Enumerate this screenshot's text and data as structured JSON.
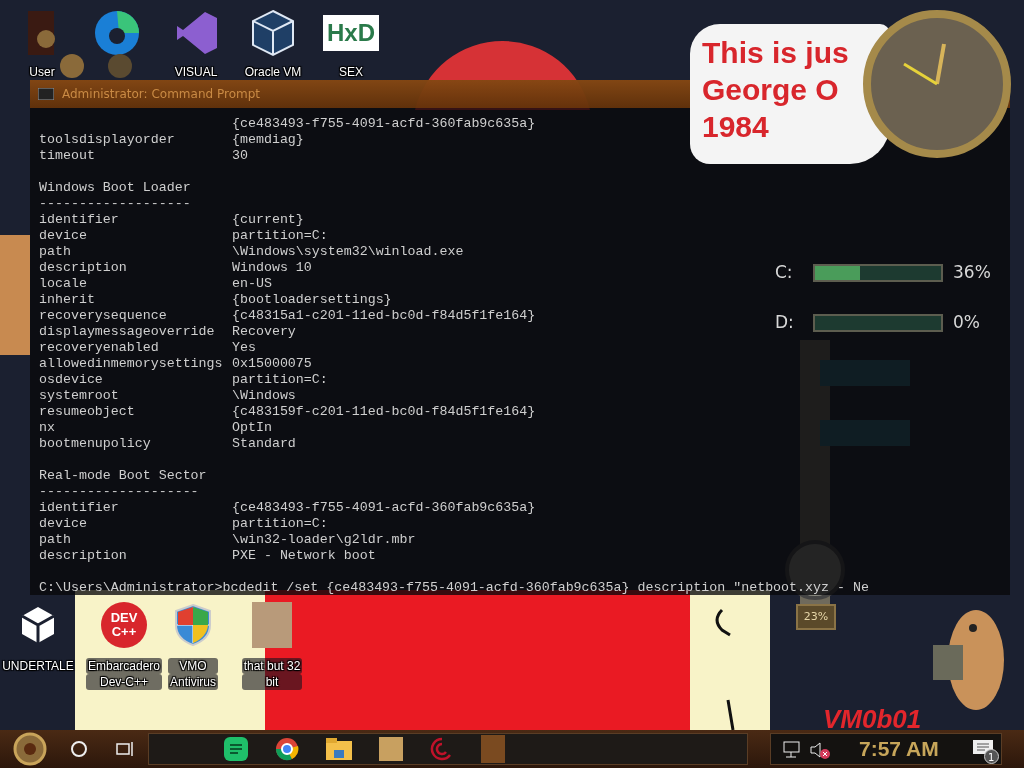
{
  "desktop_icons_top": [
    {
      "lines": [
        "User"
      ]
    },
    {
      "lines": [
        "VISUAL"
      ]
    },
    {
      "lines": [
        "Oracle VM"
      ]
    },
    {
      "lines": [
        "SEX"
      ],
      "logo": "HxD"
    }
  ],
  "desktop_icons_bottom": [
    {
      "lines": [
        "UNDERTALE"
      ]
    },
    {
      "lines": [
        "Embarcadero",
        "Dev-C++"
      ],
      "logo": [
        "DEV",
        "C++"
      ]
    },
    {
      "lines": [
        "VMO",
        "Antivirus"
      ]
    },
    {
      "lines": [
        "that but 32",
        "bit"
      ]
    }
  ],
  "poster": {
    "lines": [
      "This is jus",
      "George O",
      "1984"
    ]
  },
  "drives": [
    {
      "label": "C:",
      "level": 0.36,
      "reading": "36%"
    },
    {
      "label": "D:",
      "level": 0,
      "reading": "0%"
    }
  ],
  "pipe_gauge": {
    "reading": "23%"
  },
  "wallpaper_signature": "VM0b01",
  "command_prompt": {
    "title": "Administrator: Command Prompt",
    "lines": [
      {
        "kind": "value",
        "value": "{ce483493-f755-4091-acfd-360fab9c635a}"
      },
      {
        "kind": "pair",
        "key": "toolsdisplayorder",
        "value": "{memdiag}"
      },
      {
        "kind": "pair",
        "key": "timeout",
        "value": "30"
      },
      {
        "kind": "blank"
      },
      {
        "kind": "heading",
        "text": "Windows Boot Loader"
      },
      {
        "kind": "rule",
        "text": "-------------------"
      },
      {
        "kind": "pair",
        "key": "identifier",
        "value": "{current}"
      },
      {
        "kind": "pair",
        "key": "device",
        "value": "partition=C:"
      },
      {
        "kind": "pair",
        "key": "path",
        "value": "\\Windows\\system32\\winload.exe"
      },
      {
        "kind": "pair",
        "key": "description",
        "value": "Windows 10"
      },
      {
        "kind": "pair",
        "key": "locale",
        "value": "en-US"
      },
      {
        "kind": "pair",
        "key": "inherit",
        "value": "{bootloadersettings}"
      },
      {
        "kind": "pair",
        "key": "recoverysequence",
        "value": "{c48315a1-c201-11ed-bc0d-f84d5f1fe164}"
      },
      {
        "kind": "pair",
        "key": "displaymessageoverride",
        "value": "Recovery"
      },
      {
        "kind": "pair",
        "key": "recoveryenabled",
        "value": "Yes"
      },
      {
        "kind": "pair",
        "key": "allowedinmemorysettings",
        "value": "0x15000075"
      },
      {
        "kind": "pair",
        "key": "osdevice",
        "value": "partition=C:"
      },
      {
        "kind": "pair",
        "key": "systemroot",
        "value": "\\Windows"
      },
      {
        "kind": "pair",
        "key": "resumeobject",
        "value": "{c483159f-c201-11ed-bc0d-f84d5f1fe164}"
      },
      {
        "kind": "pair",
        "key": "nx",
        "value": "OptIn"
      },
      {
        "kind": "pair",
        "key": "bootmenupolicy",
        "value": "Standard"
      },
      {
        "kind": "blank"
      },
      {
        "kind": "heading",
        "text": "Real-mode Boot Sector"
      },
      {
        "kind": "rule",
        "text": "--------------------"
      },
      {
        "kind": "pair",
        "key": "identifier",
        "value": "{ce483493-f755-4091-acfd-360fab9c635a}"
      },
      {
        "kind": "pair",
        "key": "device",
        "value": "partition=C:"
      },
      {
        "kind": "pair",
        "key": "path",
        "value": "\\win32-loader\\g2ldr.mbr"
      },
      {
        "kind": "pair",
        "key": "description",
        "value": "PXE - Network boot"
      },
      {
        "kind": "blank"
      },
      {
        "kind": "command",
        "text": "C:\\Users\\Administrator>bcdedit /set {ce483493-f755-4091-acfd-360fab9c635a} description \"netboot.xyz - Ne"
      }
    ]
  },
  "taskbar": {
    "clock": "7:57 AM",
    "notification_count": "1",
    "sound_muted": true
  }
}
